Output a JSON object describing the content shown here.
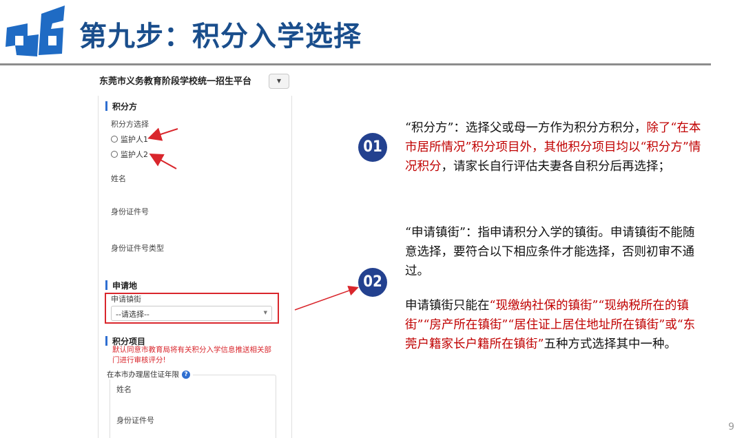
{
  "slide": {
    "title": "第九步：积分入学选择",
    "page_number": "9"
  },
  "brand_colors": {
    "title_blue": "#1a4e8c",
    "logo_blue": "#1f6bc4",
    "badge_navy": "#23418f",
    "emphasis_red": "#c00000"
  },
  "form": {
    "platform_title": "东莞市义务教育阶段学校统一招生平台",
    "dropdown_icon": "chevron-down-icon",
    "section_points": {
      "heading": "积分方",
      "choose_label": "积分方选择",
      "options": [
        "监护人1",
        "监护人2"
      ],
      "name_label": "姓名",
      "id_label": "身份证件号",
      "id_type_label": "身份证件号类型"
    },
    "section_apply": {
      "heading": "申请地",
      "street_label": "申请镇街",
      "select_placeholder": "--请选择--"
    },
    "section_items": {
      "heading": "积分项目",
      "notice": "默认同意市教育局将有关积分入学信息推送相关部门进行审核评分!",
      "group_legend": "在本市办理居住证年限",
      "name_label": "姓名",
      "id_label": "身份证件号"
    }
  },
  "explanations": {
    "badge1": "01",
    "badge2": "02",
    "p1": {
      "lead": "“积分方”：选择父或母一方作为积分方积分，",
      "red": "除了“在本市居所情况”积分项目外，其他积分项目均以“积分方”情况积分",
      "tail": "，请家长自行评估夫妻各自积分后再选择；"
    },
    "p2": "“申请镇街”：指申请积分入学的镇街。申请镇街不能随意选择，要符合以下相应条件才能选择，否则初审不通过。",
    "p3": {
      "lead": "申请镇街只能在",
      "red": "“现缴纳社保的镇街”“现纳税所在的镇街”“房产所在镇街”“居住证上居住地址所在镇街”或“东莞户籍家长户籍所在镇街”",
      "tail": "五种方式选择其中一种。"
    }
  }
}
